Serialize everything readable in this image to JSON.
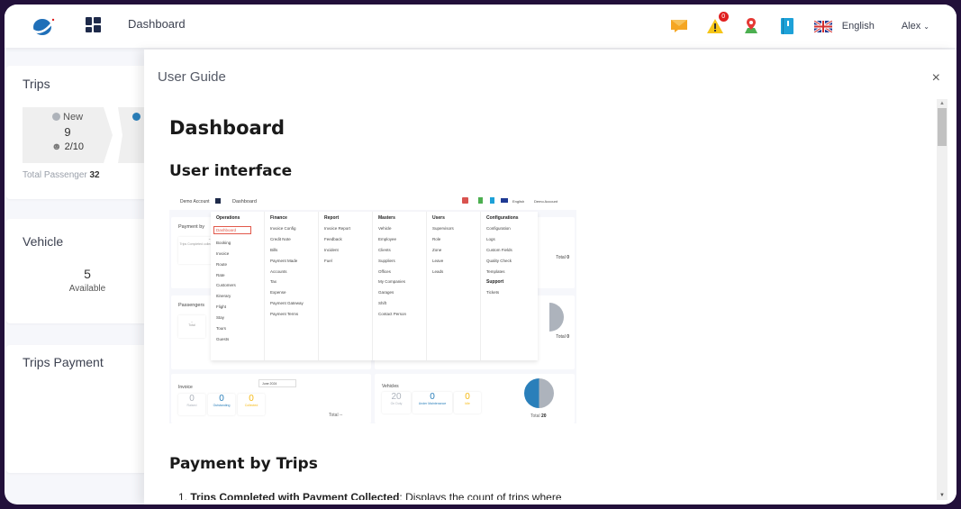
{
  "topbar": {
    "title": "Dashboard",
    "language": "English",
    "user": "Alex",
    "alert_count": "0",
    "icons": [
      "logo-icon",
      "apps-grid-icon",
      "message-icon",
      "alert-icon",
      "map-pin-icon",
      "guide-book-icon",
      "uk-flag-icon",
      "chevron-down-icon"
    ]
  },
  "cards": {
    "trips": {
      "title": "Trips",
      "step_label": "New",
      "step_count": "9",
      "step_passengers": "2/10",
      "total_label": "Total Passenger",
      "total_value": "32"
    },
    "vehicle": {
      "title": "Vehicle",
      "value": "5",
      "label": "Available"
    },
    "trips_payment": {
      "title": "Trips Payment"
    }
  },
  "modal": {
    "title": "User Guide",
    "close": "×",
    "h1": "Dashboard",
    "h2_ui": "User interface",
    "h2_payment": "Payment by Trips",
    "list_num": "1.",
    "list_bold": "Trips Completed with Payment Collected",
    "list_text": ": Displays the count of trips where"
  },
  "screenshot": {
    "account": "Demo Account",
    "title": "Dashboard",
    "language": "English",
    "user": "Demo Account",
    "payment_by": "Payment by",
    "passengers": "Passengers",
    "trips_completed": "Trips Completed collec",
    "dash": "--",
    "total_word": "Total",
    "total_zero": "0",
    "menu": [
      {
        "header": "Operations",
        "items": [
          "Dashboard",
          "Booking",
          "Invoice",
          "Route",
          "Rate",
          "Customers",
          "Itinerary",
          "Flight",
          "Stay",
          "Tours",
          "Guests"
        ]
      },
      {
        "header": "Finance",
        "items": [
          "Invoice Config",
          "Credit Note",
          "Bills",
          "Payment Made",
          "Accounts",
          "Tax",
          "Expense",
          "Payment Gateway",
          "Payment Terms"
        ]
      },
      {
        "header": "Report",
        "items": [
          "Invoice Report",
          "Feedback",
          "Incident",
          "Fuel"
        ]
      },
      {
        "header": "Masters",
        "items": [
          "Vehicle",
          "Employee",
          "Clients",
          "Suppliers",
          "Offices",
          "My Companies",
          "Garages",
          "Shift",
          "Contact Person"
        ]
      },
      {
        "header": "Users",
        "items": [
          "Supervisors",
          "Role",
          "Zone",
          "Leave",
          "Leads"
        ]
      },
      {
        "header": "Configurations",
        "items": [
          "Configuration",
          "Logs",
          "Custom Fields",
          "Quality Check",
          "Templates"
        ],
        "header2": "Support",
        "items2": [
          "Tickets"
        ]
      }
    ],
    "invoice": {
      "title": "Invoice",
      "date": "June 2024",
      "raised": "0",
      "raised_label": "Raised",
      "outstanding": "0",
      "outstanding_label": "Outstanding",
      "collected": "0",
      "collected_label": "Collected",
      "total": "Total --"
    },
    "vehicles": {
      "title": "Vehicles",
      "on_duty": "20",
      "on_duty_label": "On Duty",
      "maintenance": "0",
      "maintenance_label": "Under Maintenance",
      "idle": "0",
      "idle_label": "Idle",
      "total_label": "Total",
      "total_value": "20"
    }
  },
  "colors": {
    "accent_blue": "#2a7fba",
    "amber": "#f5b914",
    "gray": "#adb3bc",
    "frame": "#22103a"
  }
}
